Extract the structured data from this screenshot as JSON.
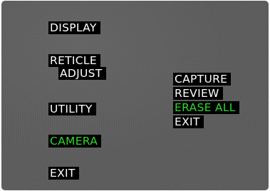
{
  "main_menu": {
    "items": [
      {
        "label": "DISPLAY",
        "state": "normal"
      },
      {
        "label": "RETICLE",
        "state": "normal"
      },
      {
        "label": "ADJUST",
        "state": "normal"
      },
      {
        "label": "UTILITY",
        "state": "normal"
      },
      {
        "label": "CAMERA",
        "state": "selected"
      },
      {
        "label": "EXIT",
        "state": "normal"
      }
    ]
  },
  "camera_submenu": {
    "items": [
      {
        "label": "CAPTURE",
        "state": "normal"
      },
      {
        "label": "REVIEW",
        "state": "normal"
      },
      {
        "label": "ERASE ALL",
        "state": "selected"
      },
      {
        "label": "EXIT",
        "state": "normal"
      }
    ]
  },
  "colors": {
    "text_normal": "#ffffff",
    "text_selected": "#2bd92b",
    "label_background": "#000000",
    "screen_background": "#5a5a5a"
  }
}
